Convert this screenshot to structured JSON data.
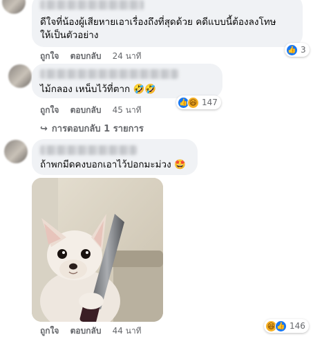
{
  "comments": [
    {
      "text_lines": [
        "ดีใจที่น้องผู้เสียหายเอาเรื่องถึงที่สุดด้วย คดีแบบนี้ต้องลงโทษ",
        "ให้เป็นตัวอย่าง"
      ],
      "like_label": "ถูกใจ",
      "reply_label": "ตอบกลับ",
      "time": "24 นาที",
      "reaction_icons": [
        "like-icon"
      ],
      "reaction_count": "3"
    },
    {
      "text": "ไม้กลอง เหน็บไว้ที่ตาก 🤣🤣",
      "like_label": "ถูกใจ",
      "reply_label": "ตอบกลับ",
      "time": "45 นาที",
      "reaction_icons": [
        "like-icon",
        "haha-icon"
      ],
      "reaction_count": "147",
      "view_replies": "การตอบกลับ 1 รายการ"
    },
    {
      "text": "ถ้าพกมีดคงบอกเอาไว้ปอกมะม่วง 🤩",
      "like_label": "ถูกใจ",
      "reply_label": "ตอบกลับ",
      "time": "44 นาที",
      "reaction_icons": [
        "haha-icon",
        "like-icon"
      ],
      "reaction_count": "146"
    }
  ],
  "colors": {
    "bubble": "#f0f2f5",
    "meta": "#65676b",
    "like": "#1877f2",
    "haha": "#f7b125"
  }
}
